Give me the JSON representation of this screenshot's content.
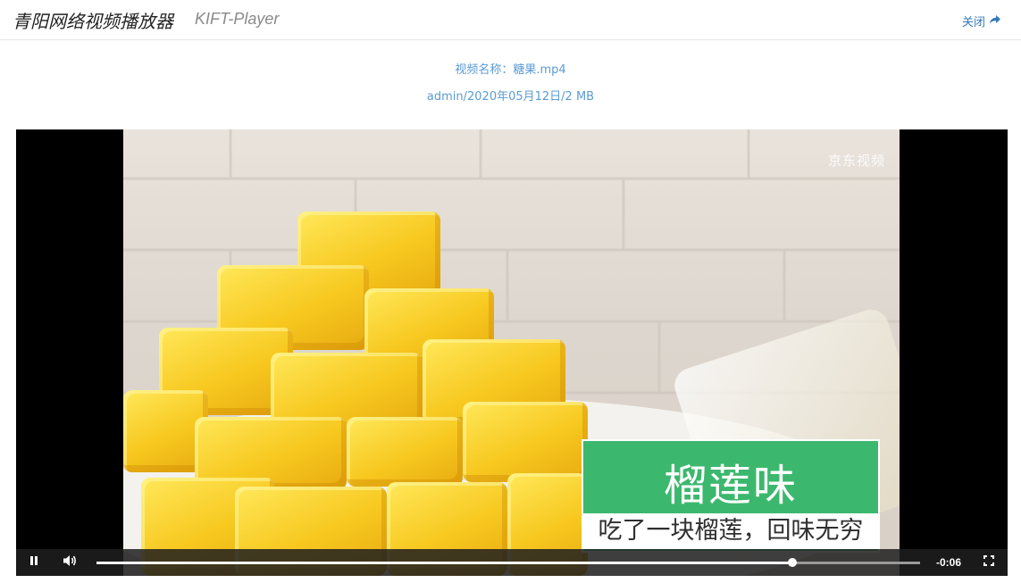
{
  "header": {
    "title": "青阳网络视频播放器",
    "subtitle": "KIFT-Player",
    "close_label": "关闭"
  },
  "info": {
    "name_line": "视频名称：糖果.mp4",
    "meta_line": "admin/2020年05月12日/2 MB"
  },
  "video": {
    "watermark": "京东视频",
    "caption_main": "榴莲味",
    "caption_sub": "吃了一块榴莲，回味无穷"
  },
  "controls": {
    "time_remaining": "-0:06",
    "progress": 0.845,
    "pause_icon": "pause-icon",
    "volume_icon": "volume-icon",
    "fullscreen_icon": "fullscreen-icon"
  },
  "colors": {
    "link": "#337ab7",
    "info": "#5b9bd5",
    "caption_green": "#3cb86e"
  }
}
